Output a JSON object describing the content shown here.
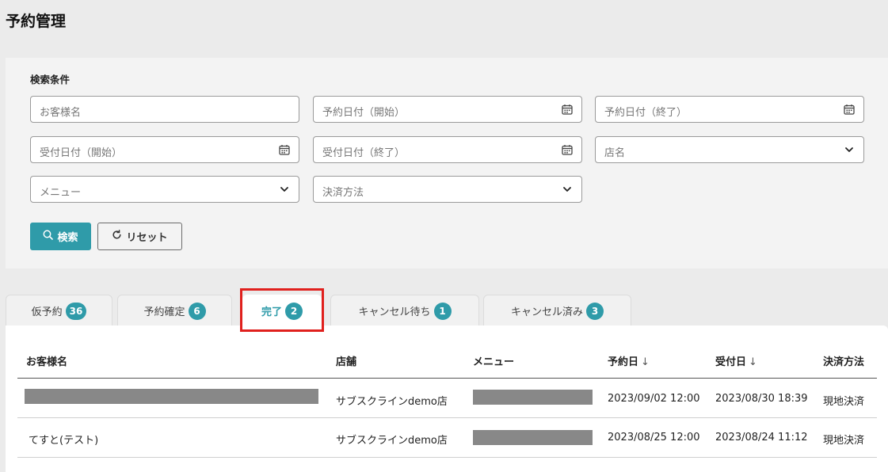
{
  "page": {
    "title": "予約管理"
  },
  "search": {
    "heading": "検索条件",
    "fields": {
      "customer_name": {
        "placeholder": "お客様名"
      },
      "reservation_date_start": {
        "placeholder": "予約日付（開始）"
      },
      "reservation_date_end": {
        "placeholder": "予約日付（終了）"
      },
      "received_date_start": {
        "placeholder": "受付日付（開始）"
      },
      "received_date_end": {
        "placeholder": "受付日付（終了）"
      },
      "store": {
        "placeholder": "店名"
      },
      "menu": {
        "placeholder": "メニュー"
      },
      "payment_method": {
        "placeholder": "決済方法"
      }
    },
    "search_button": "検索",
    "reset_button": "リセット"
  },
  "tabs": [
    {
      "label": "仮予約",
      "count": "36"
    },
    {
      "label": "予約確定",
      "count": "6"
    },
    {
      "label": "完了",
      "count": "2",
      "active": true
    },
    {
      "label": "キャンセル待ち",
      "count": "1"
    },
    {
      "label": "キャンセル済み",
      "count": "3"
    }
  ],
  "table": {
    "columns": [
      "お客様名",
      "店舗",
      "メニュー",
      "予約日",
      "受付日",
      "決済方法"
    ],
    "rows": [
      {
        "customer": "",
        "store": "サブスクラインdemo店",
        "menu": "",
        "reservation_date": "2023/09/02 12:00",
        "received_date": "2023/08/30 18:39",
        "payment": "現地決済"
      },
      {
        "customer": "てすと(テスト)",
        "store": "サブスクラインdemo店",
        "menu": "",
        "reservation_date": "2023/08/25 12:00",
        "received_date": "2023/08/24 11:12",
        "payment": "現地決済"
      }
    ]
  },
  "colors": {
    "accent": "#2f9ba9",
    "highlight": "#e0201d",
    "redacted": "#888888"
  }
}
